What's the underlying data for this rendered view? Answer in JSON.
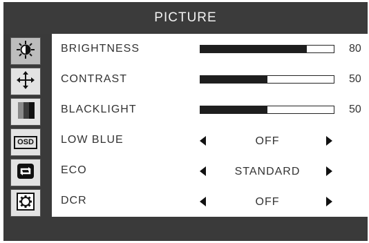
{
  "title": "PICTURE",
  "sidebar": {
    "items": [
      {
        "icon": "brightness-icon",
        "active": true
      },
      {
        "icon": "move-arrows-icon",
        "active": false
      },
      {
        "icon": "color-bars-icon",
        "active": false
      },
      {
        "icon": "osd-icon",
        "label": "OSD",
        "active": false
      },
      {
        "icon": "refresh-icon",
        "active": false
      },
      {
        "icon": "gear-icon",
        "active": false
      }
    ]
  },
  "settings": [
    {
      "label": "BRIGHTNESS",
      "type": "slider",
      "value": 80
    },
    {
      "label": "CONTRAST",
      "type": "slider",
      "value": 50
    },
    {
      "label": "BLACKLIGHT",
      "type": "slider",
      "value": 50
    },
    {
      "label": "LOW BLUE",
      "type": "option",
      "option": "OFF"
    },
    {
      "label": "ECO",
      "type": "option",
      "option": "STANDARD"
    },
    {
      "label": "DCR",
      "type": "option",
      "option": "OFF"
    }
  ]
}
